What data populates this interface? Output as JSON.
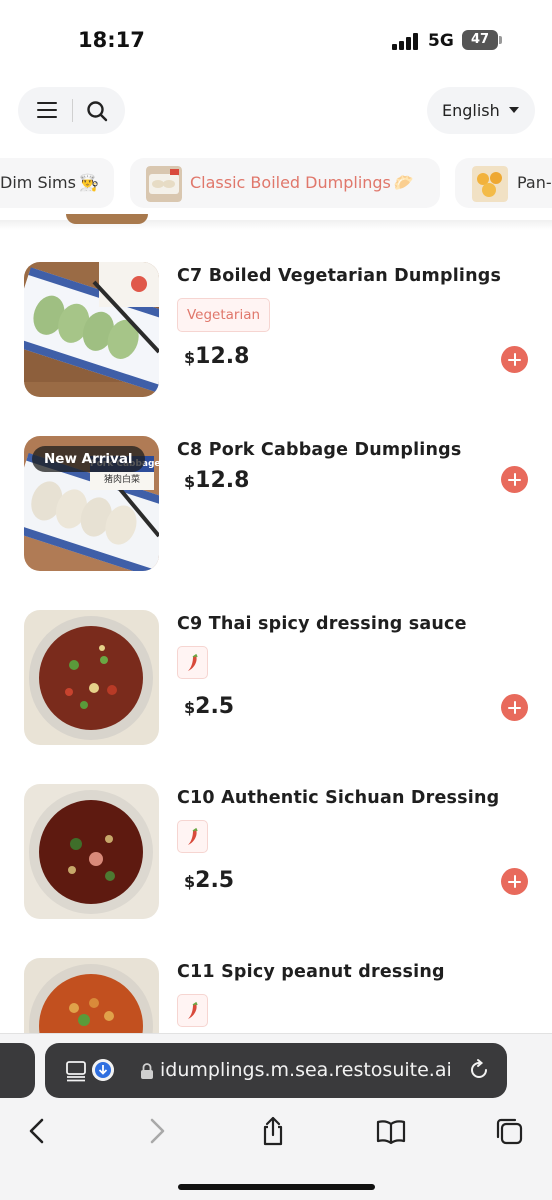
{
  "status_bar": {
    "time": "18:17",
    "network": "5G",
    "battery": "47"
  },
  "header": {
    "language": "English"
  },
  "categories": [
    {
      "label": "Dim Sims",
      "emoji": "👨‍🍳",
      "active": false
    },
    {
      "label": "Classic Boiled Dumplings",
      "emoji": "🥟",
      "active": true
    },
    {
      "label": "Pan-",
      "emoji": "",
      "active": false
    }
  ],
  "items": [
    {
      "title": "C7 Boiled Vegetarian Dumplings",
      "tag": "Vegetarian",
      "currency": "$",
      "price": "12.8"
    },
    {
      "title": "C8 Pork Cabbage Dumplings",
      "badge": "New Arrival",
      "package_label": "Pork Cabbage",
      "package_sub": "猪肉白菜",
      "currency": "$",
      "price": "12.8"
    },
    {
      "title": "C9 Thai spicy dressing sauce",
      "spicy_icon": "chili-icon",
      "currency": "$",
      "price": "2.5"
    },
    {
      "title": "C10 Authentic Sichuan Dressing",
      "spicy_icon": "chili-icon",
      "currency": "$",
      "price": "2.5"
    },
    {
      "title": "C11 Spicy peanut dressing",
      "spicy_icon": "chili-icon"
    }
  ],
  "browser": {
    "url": "idumplings.m.sea.restosuite.ai"
  },
  "colors": {
    "accent": "#e86a5c",
    "tag_bg": "#fff4f3",
    "tag_text": "#e0776b",
    "urlbar": "#3a3a3c"
  }
}
